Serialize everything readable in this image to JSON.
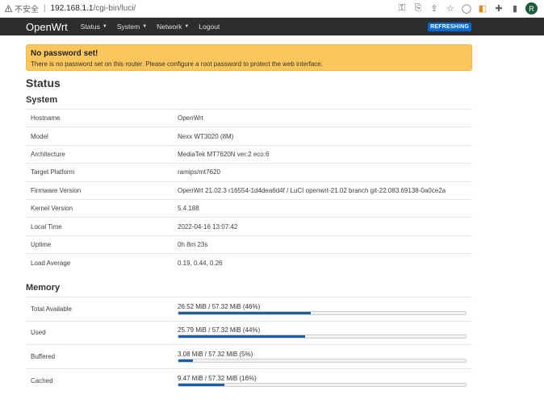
{
  "browser": {
    "security_label": "不安全",
    "url_host": "192.168.1.1",
    "url_path": "/cgi-bin/luci/",
    "profile_initial": "R"
  },
  "nav": {
    "brand": "OpenWrt",
    "items": [
      "Status",
      "System",
      "Network"
    ],
    "logout": "Logout",
    "badge": "REFRESHING"
  },
  "alert": {
    "title": "No password set!",
    "message": "There is no password set on this router. Please configure a root password to protect the web interface."
  },
  "page_title": "Status",
  "system": {
    "title": "System",
    "rows": [
      {
        "key": "Hostname",
        "value": "OpenWrt"
      },
      {
        "key": "Model",
        "value": "Nexx WT3020 (8M)"
      },
      {
        "key": "Architecture",
        "value": "MediaTek MT7620N ver:2 eco:6"
      },
      {
        "key": "Target Platform",
        "value": "ramips/mt7620"
      },
      {
        "key": "Firmware Version",
        "value": "OpenWrt 21.02.3 r16554-1d4dea6d4f / LuCI openwrt-21.02 branch git-22.083.69138-0a0ce2a"
      },
      {
        "key": "Kernel Version",
        "value": "5.4.188"
      },
      {
        "key": "Local Time",
        "value": "2022-04-16 13:07:42"
      },
      {
        "key": "Uptime",
        "value": "0h 8m 23s"
      },
      {
        "key": "Load Average",
        "value": "0.19, 0.44, 0.26"
      }
    ]
  },
  "memory": {
    "title": "Memory",
    "rows": [
      {
        "key": "Total Available",
        "value": "26.52 MiB / 57.32 MiB (46%)",
        "percent": 46
      },
      {
        "key": "Used",
        "value": "25.79 MiB / 57.32 MiB (44%)",
        "percent": 44
      },
      {
        "key": "Buffered",
        "value": "3.08 MiB / 57.32 MiB (5%)",
        "percent": 5
      },
      {
        "key": "Cached",
        "value": "9.47 MiB / 57.32 MiB (16%)",
        "percent": 16
      }
    ]
  },
  "colors": {
    "navbar": "#2d2d2d",
    "alert": "#fbc75d",
    "badge": "#0069d6",
    "progress_fill": "#1d5ea8"
  }
}
